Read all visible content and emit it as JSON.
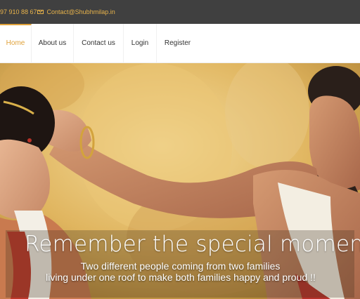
{
  "topbar": {
    "phone": "97 910 88 67",
    "email": "Contact@Shubhmilap.in",
    "email_icon": "envelope-icon",
    "background": "#404040",
    "accent": "#e7b24a"
  },
  "nav": {
    "items": [
      {
        "label": "Home",
        "active": true
      },
      {
        "label": "About us",
        "active": false
      },
      {
        "label": "Contact us",
        "active": false
      },
      {
        "label": "Login",
        "active": false
      },
      {
        "label": "Register",
        "active": false
      }
    ],
    "active_color": "#e0a23a"
  },
  "hero": {
    "title": "Remember the special moment",
    "subtitle_line1": "Two different people coming from two families",
    "subtitle_line2": "living under one roof to make both families happy and proud !!"
  }
}
